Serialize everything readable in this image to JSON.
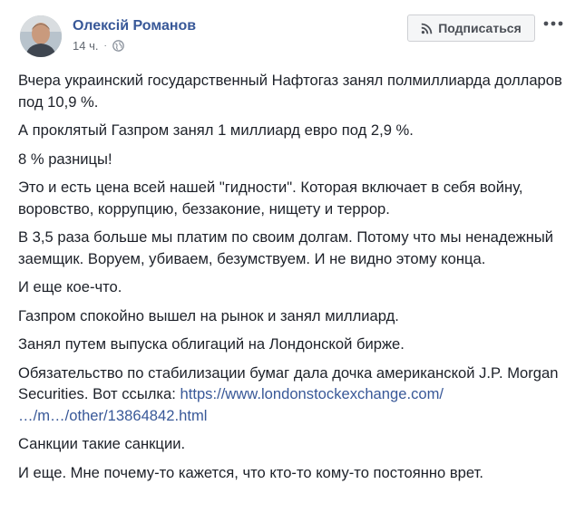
{
  "author": {
    "name": "Олексій Романов"
  },
  "meta": {
    "time": "14 ч.",
    "separator": "·",
    "visibility_icon": "globe-icon"
  },
  "actions": {
    "subscribe_label": "Подписаться",
    "subscribe_icon": "rss-icon",
    "more_icon": "ellipsis-icon"
  },
  "colors": {
    "link": "#385898",
    "text": "#1d2129",
    "muted": "#616770"
  },
  "paragraphs": {
    "p1": "Вчера украинский государственный Нафтогаз занял полмиллиарда долларов под 10,9 %.",
    "p2": "А проклятый Газпром занял 1 миллиард евро под 2,9 %.",
    "p3": "8 % разницы!",
    "p4": "Это и есть цена всей нашей \"гидности\". Которая включает в себя войну, воровство, коррупцию, беззаконие, нищету и террор.",
    "p5": "В 3,5 раза больше мы платим по своим долгам. Потому что мы ненадежный заемщик. Воруем, убиваем, безумствуем. И не видно этому конца.",
    "p6": "И еще кое-что.",
    "p7": "Газпром спокойно вышел на рынок и занял миллиард.",
    "p8": "Занял путем выпуска облигаций на Лондонской бирже.",
    "p9": {
      "text": "Обязательство по стабилизации бумаг дала дочка американской J.P. Morgan Securities. Вот ссылка: ",
      "link_line1": "https://www.londonstockexchange.com/",
      "link_line2": "…/m…/other/13864842.html"
    },
    "p10": "Санкции такие санкции.",
    "p11": "И еще. Мне почему-то кажется, что кто-то кому-то постоянно врет."
  }
}
